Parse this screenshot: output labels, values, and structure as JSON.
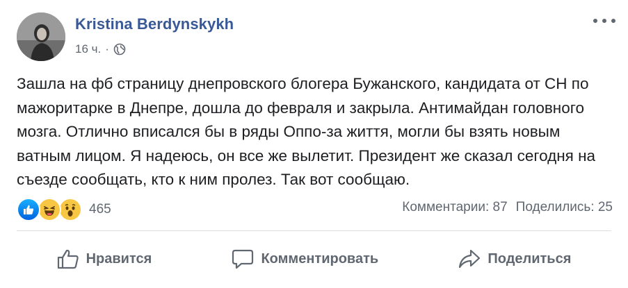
{
  "post": {
    "author": "Kristina Berdynskykh",
    "timestamp": "16 ч.",
    "separator": "·",
    "privacy_icon": "globe-icon",
    "text": "Зашла на фб страницу днепровского блогера Бужанского, кандидата от СН по мажоритарке в Днепре, дошла до февраля и закрыла. Антимайдан головного мозга. Отлично вписался бы в ряды Оппо-за життя, могли бы взять новым ватным лицом. Я надеюсь, он все же вылетит. Президент же сказал сегодня на съезде сообщать, кто к ним пролез. Так вот сообщаю."
  },
  "reactions": {
    "icons": [
      "like-icon",
      "haha-icon",
      "wow-icon"
    ],
    "count": "465"
  },
  "stats": {
    "comments": "Комментарии: 87",
    "shares": "Поделились: 25"
  },
  "actions": {
    "like": "Нравится",
    "comment": "Комментировать",
    "share": "Поделиться"
  },
  "colors": {
    "author_link": "#385898",
    "secondary_text": "#606770",
    "body_text": "#1c1e21",
    "divider": "#dadde1",
    "like_blue": "#1877f2",
    "reaction_yellow": "#f7c744"
  }
}
